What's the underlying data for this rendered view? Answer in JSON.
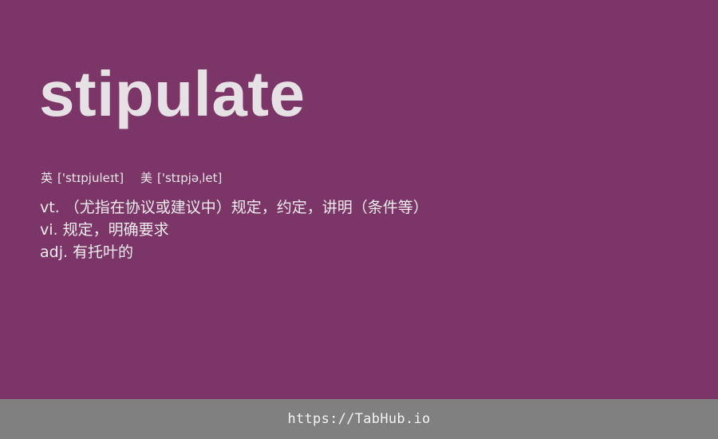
{
  "word": "stipulate",
  "phonetics": {
    "uk": {
      "label": "英",
      "ipa": "['stɪpjuleɪt]"
    },
    "us": {
      "label": "美",
      "ipa": "['stɪpjəˌlet]"
    }
  },
  "definitions": [
    {
      "pos": "vt.",
      "meaning": "（尤指在协议或建议中）规定，约定，讲明（条件等）"
    },
    {
      "pos": "vi.",
      "meaning": "规定，明确要求"
    },
    {
      "pos": "adj.",
      "meaning": "有托叶的"
    }
  ],
  "footer": {
    "link": "https://TabHub.io"
  },
  "colors": {
    "background": "#7b3566",
    "word": "#e5e1e4",
    "footer_bg": "#808080",
    "footer_text": "#f4f4f4"
  }
}
